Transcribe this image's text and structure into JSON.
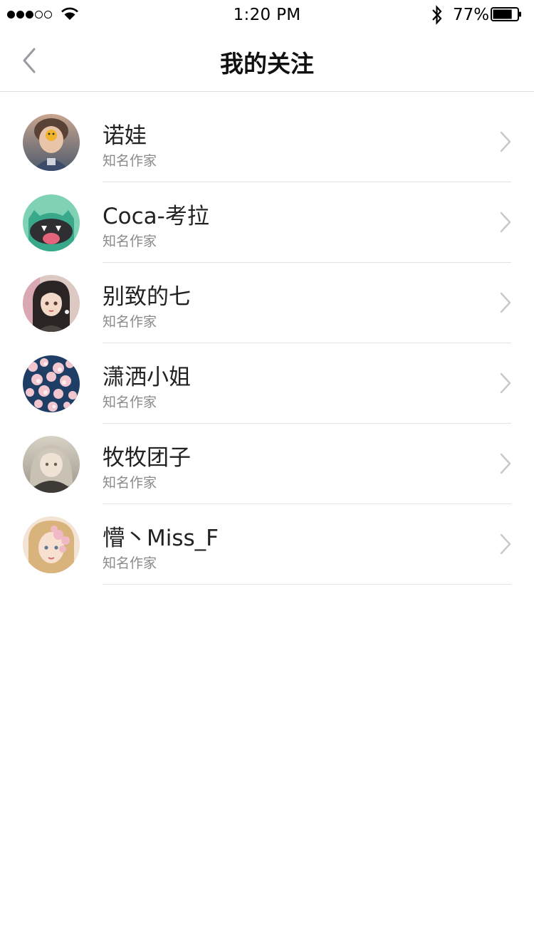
{
  "status_bar": {
    "signal_bars_filled": 3,
    "signal_bars_total": 5,
    "wifi_icon": "wifi-icon",
    "time": "1:20 PM",
    "bluetooth_icon": "bluetooth-icon",
    "battery_percent": "77%",
    "battery_level": 0.77
  },
  "nav": {
    "back_icon": "chevron-left-icon",
    "title": "我的关注"
  },
  "following": [
    {
      "name": "诺娃",
      "desc": "知名作家",
      "avatar_colors": [
        "#6b5a52",
        "#a0786a"
      ]
    },
    {
      "name": "Coca-考拉",
      "desc": "知名作家",
      "avatar_colors": [
        "#7fd3b4",
        "#3aa98b"
      ]
    },
    {
      "name": "别致的七",
      "desc": "知名作家",
      "avatar_colors": [
        "#d8c4be",
        "#2a2424"
      ]
    },
    {
      "name": "潇洒小姐",
      "desc": "知名作家",
      "avatar_colors": [
        "#1f3e66",
        "#f2c6cf"
      ]
    },
    {
      "name": "牧牧团子",
      "desc": "知名作家",
      "avatar_colors": [
        "#bdb6a8",
        "#3e3a36"
      ]
    },
    {
      "name": "懵丶Miss_F",
      "desc": "知名作家",
      "avatar_colors": [
        "#f1dccd",
        "#c8a46e"
      ]
    }
  ],
  "colors": {
    "divider": "#e4e4e4",
    "chevron": "#c7c7cc",
    "subtitle": "#8a8a8a"
  }
}
